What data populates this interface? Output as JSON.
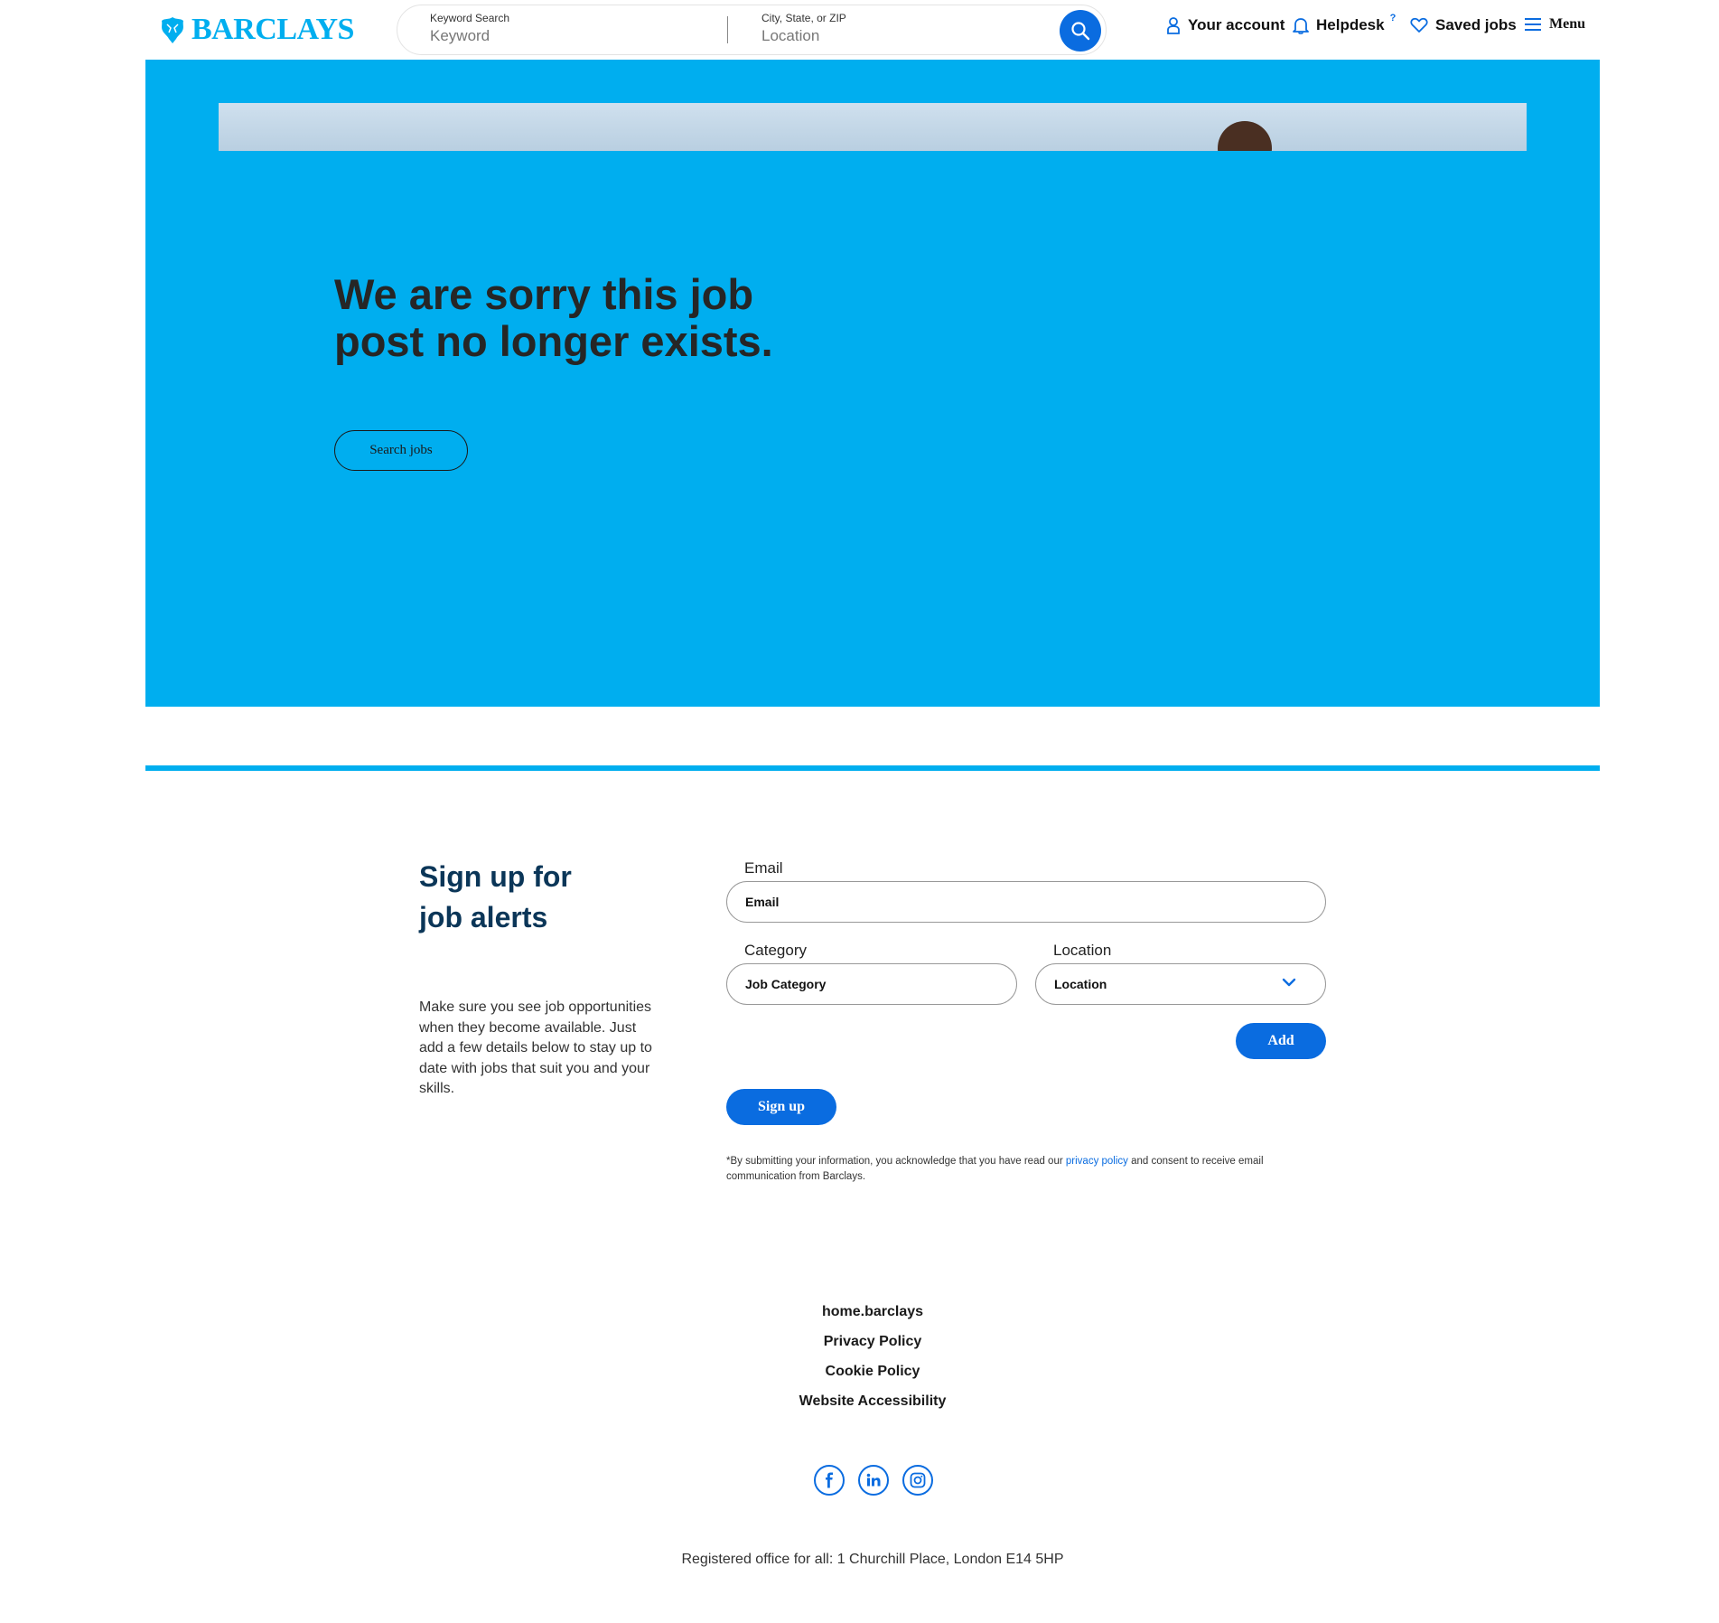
{
  "header": {
    "brand": "BARCLAYS",
    "search": {
      "keyword_label": "Keyword Search",
      "keyword_placeholder": "Keyword",
      "location_label": "City, State, or ZIP",
      "location_placeholder": "Location"
    },
    "nav": {
      "account": "Your account",
      "helpdesk": "Helpdesk",
      "helpdesk_sup": "?",
      "saved": "Saved jobs",
      "menu": "Menu"
    }
  },
  "hero": {
    "title": "We are sorry this job post no longer exists.",
    "button": "Search jobs"
  },
  "signup": {
    "title": "Sign up for job alerts",
    "description": "Make sure you see job opportunities when they become available. Just add a few details below to stay up to date with jobs that suit you and your skills.",
    "email_label": "Email",
    "email_placeholder": "Email",
    "category_label": "Category",
    "category_placeholder": "Job Category",
    "location_label": "Location",
    "location_value": "Location",
    "add_button": "Add",
    "signup_button": "Sign up",
    "disclaimer_pre": "*By submitting your information, you acknowledge that you have read our ",
    "disclaimer_link": "privacy policy",
    "disclaimer_post": " and consent to receive email communication from Barclays."
  },
  "footer": {
    "links": [
      "home.barclays",
      "Privacy Policy",
      "Cookie Policy",
      "Website Accessibility"
    ],
    "social": [
      "facebook-icon",
      "linkedin-icon",
      "instagram-icon"
    ],
    "address": "Registered office for all: 1 Churchill Place, London E14 5HP"
  },
  "colors": {
    "brand_cyan": "#00aeef",
    "action_blue": "#0a6ce0",
    "heading_navy": "#0b3658"
  }
}
